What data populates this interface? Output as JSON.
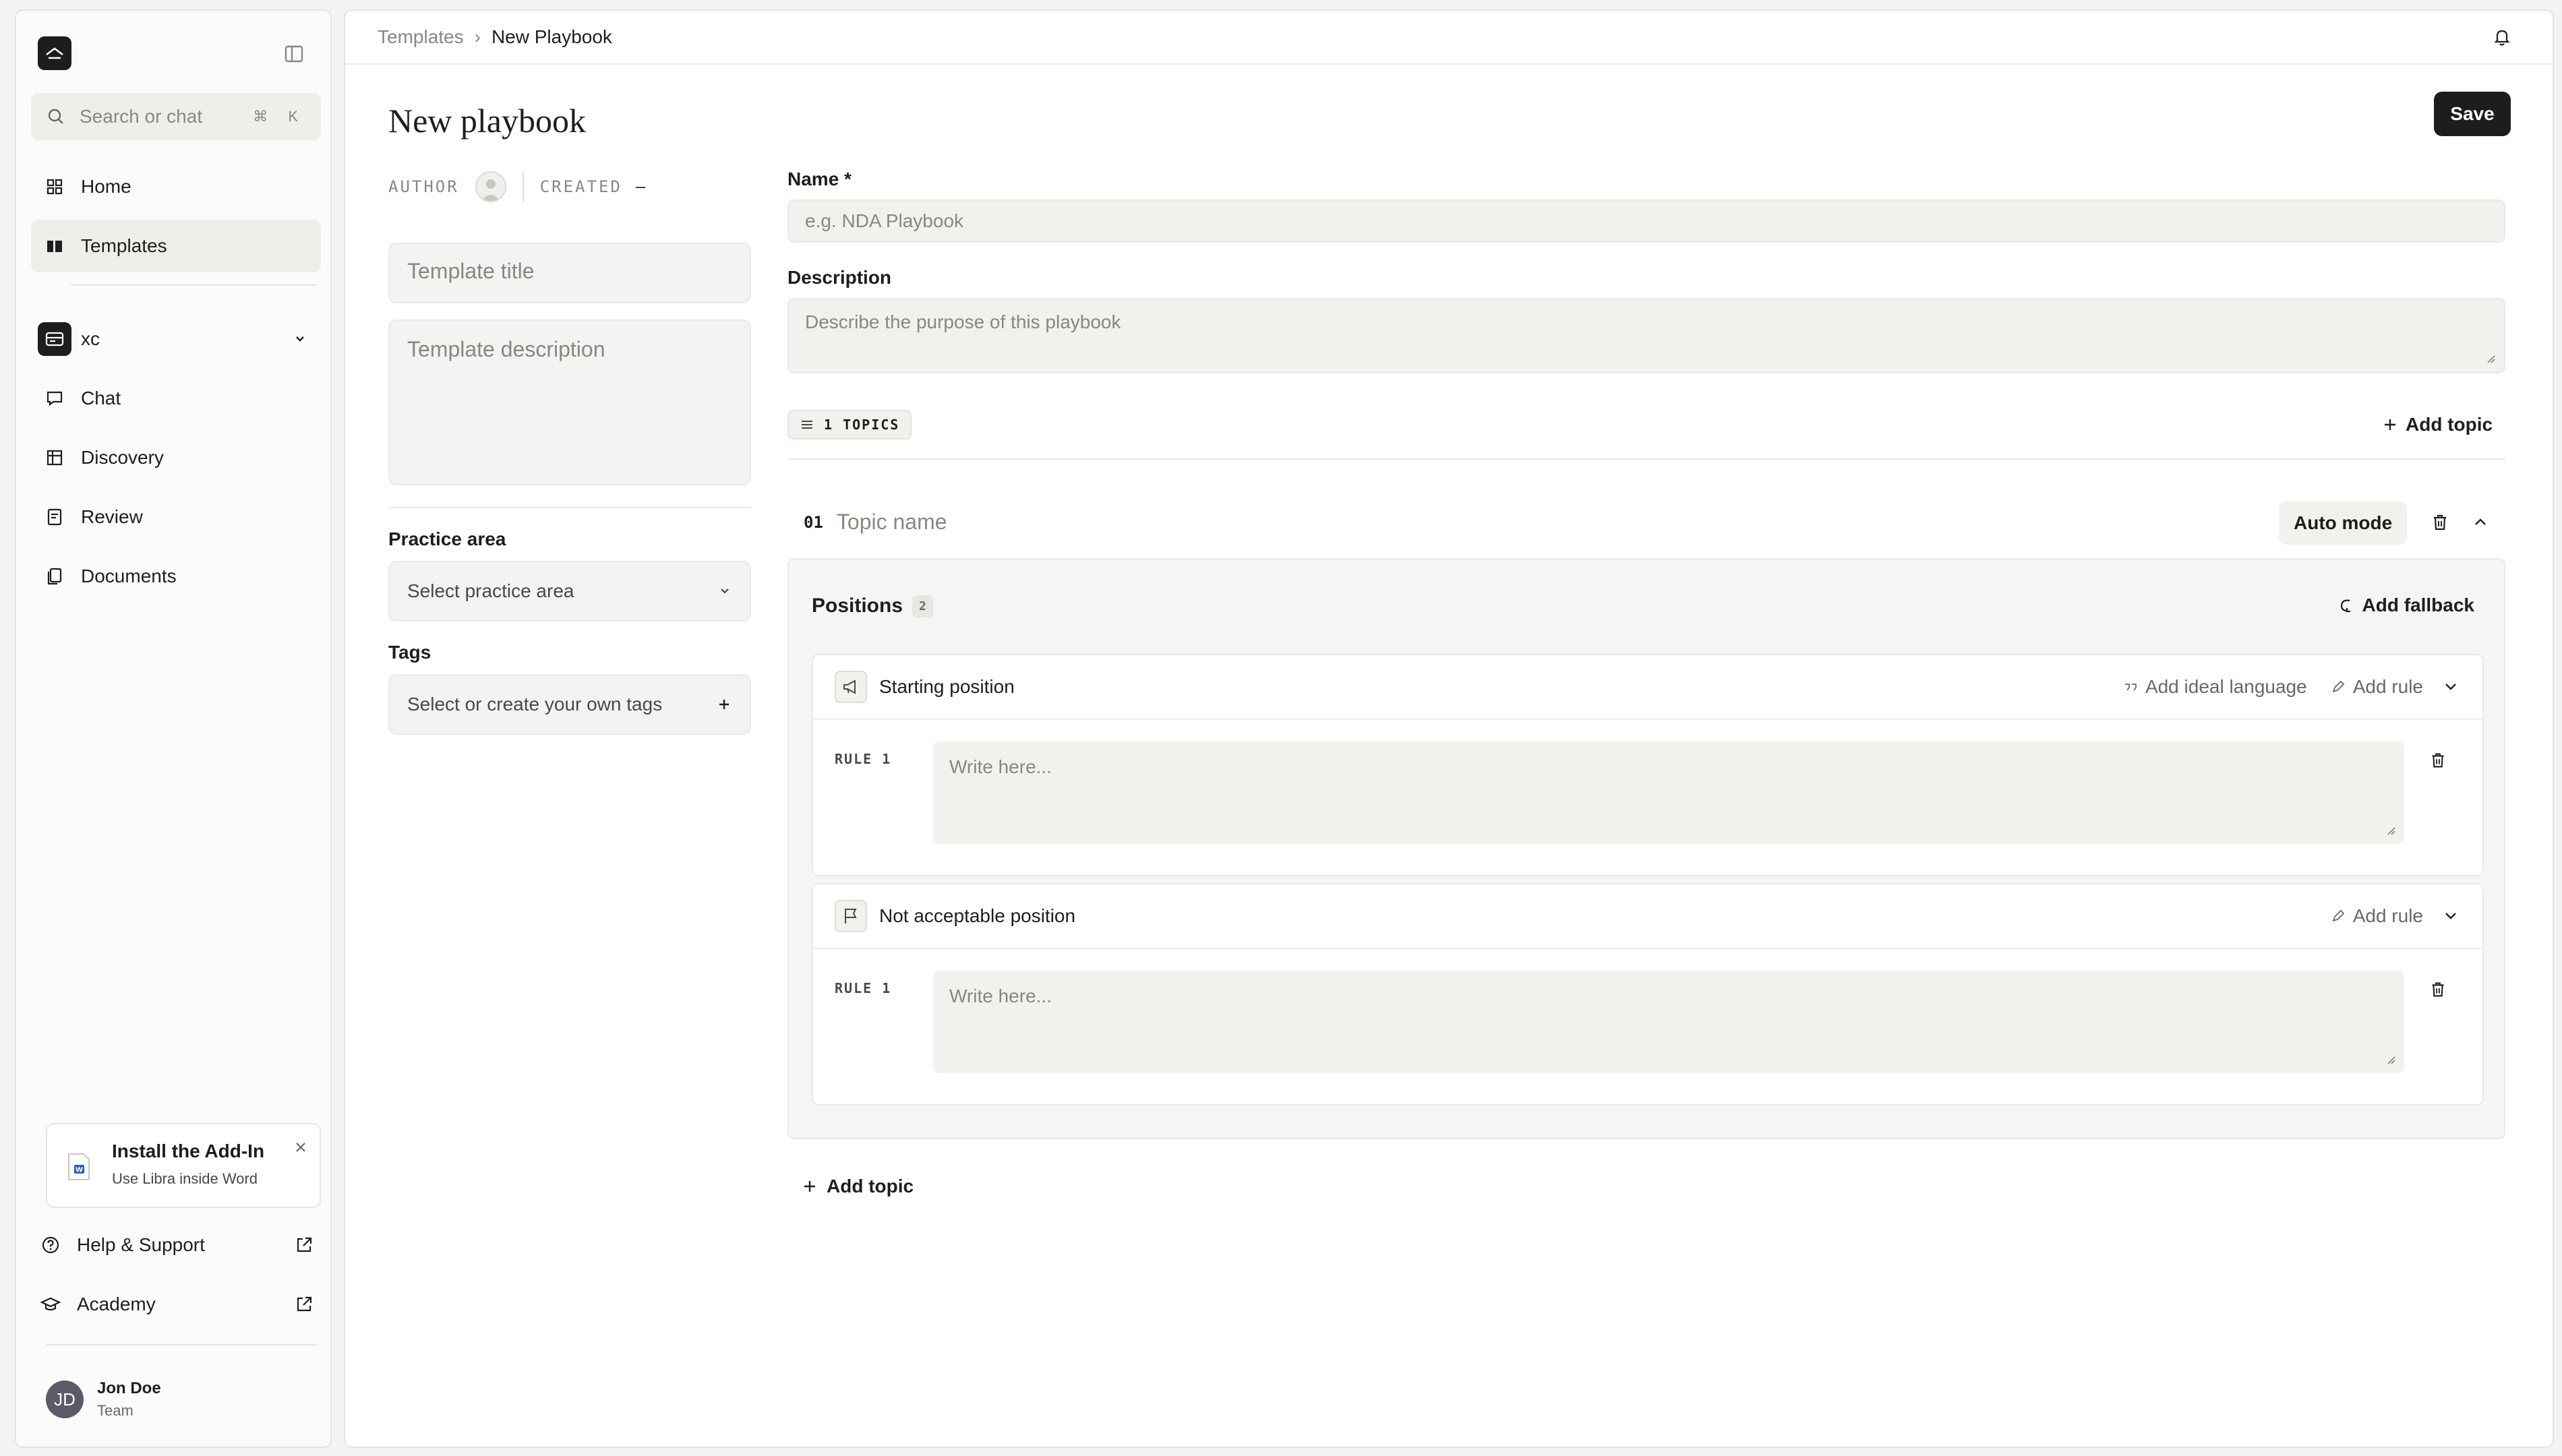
{
  "sidebar": {
    "search_placeholder": "Search or chat",
    "search_shortcut": "⌘ K",
    "nav_top": [
      {
        "label": "Home",
        "icon": "home-icon"
      },
      {
        "label": "Templates",
        "icon": "templates-icon",
        "active": true
      }
    ],
    "workspace": {
      "label": "xc"
    },
    "nav_workspace": [
      {
        "label": "Chat",
        "icon": "chat-icon"
      },
      {
        "label": "Discovery",
        "icon": "table-icon"
      },
      {
        "label": "Review",
        "icon": "review-icon"
      },
      {
        "label": "Documents",
        "icon": "documents-icon"
      }
    ],
    "addin": {
      "title": "Install the Add-In",
      "subtitle": "Use Libra inside Word"
    },
    "footer_links": [
      {
        "label": "Help & Support",
        "icon": "help-icon"
      },
      {
        "label": "Academy",
        "icon": "academy-icon"
      }
    ],
    "user": {
      "initials": "JD",
      "name": "Jon Doe",
      "team": "Team"
    }
  },
  "header": {
    "breadcrumb": [
      "Templates",
      "New Playbook"
    ]
  },
  "page": {
    "title": "New playbook",
    "save_label": "Save",
    "meta": {
      "author_label": "AUTHOR",
      "created_label": "CREATED",
      "created_value": "–"
    },
    "template_title_placeholder": "Template title",
    "template_description_placeholder": "Template description",
    "practice_area_label": "Practice area",
    "practice_area_placeholder": "Select practice area",
    "tags_label": "Tags",
    "tags_placeholder": "Select or create your own tags"
  },
  "form": {
    "name_label": "Name *",
    "name_placeholder": "e.g. NDA Playbook",
    "description_label": "Description",
    "description_placeholder": "Describe the purpose of this playbook",
    "topics_count": "1 TOPICS",
    "add_topic_label": "Add topic"
  },
  "topic": {
    "number": "01",
    "name_placeholder": "Topic name",
    "mode_label": "Auto mode",
    "positions_label": "Positions",
    "positions_count": "2",
    "add_fallback_label": "Add fallback",
    "positions": [
      {
        "title": "Starting position",
        "add_ideal_language": "Add ideal language",
        "add_rule": "Add rule",
        "rule_label": "RULE 1",
        "rule_placeholder": "Write here..."
      },
      {
        "title": "Not acceptable position",
        "add_rule": "Add rule",
        "rule_label": "RULE 1",
        "rule_placeholder": "Write here..."
      }
    ]
  },
  "colors": {
    "accent_dark": "#1e1d1b",
    "background": "#f4f3f1",
    "muted_text": "#8a8782"
  }
}
